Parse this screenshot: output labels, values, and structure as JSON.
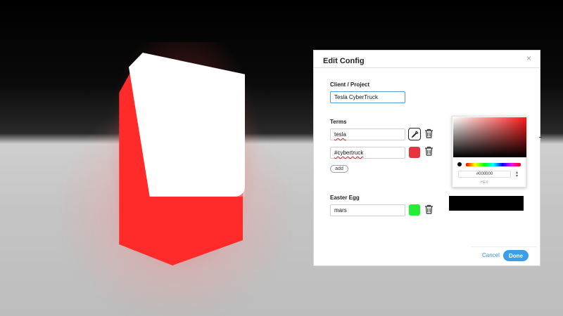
{
  "dialog": {
    "title": "Edit Config",
    "close_label": "×"
  },
  "client": {
    "label": "Client / Project",
    "value": "Tesla CyberTruck"
  },
  "terms": {
    "label": "Terms",
    "items": [
      {
        "value": "tesla",
        "color": "#ffffff"
      },
      {
        "value": "#cybertruck",
        "color": "#e8343e"
      }
    ],
    "add_label": "add"
  },
  "easter_egg": {
    "label": "Easter Egg",
    "value": "mars",
    "color": "#22ee33"
  },
  "picker": {
    "hex_value": "#000000",
    "mode_label": "HEX",
    "preview_color": "#000000"
  },
  "footer": {
    "cancel_label": "Cancel",
    "done_label": "Done"
  },
  "icons": {
    "eyedropper": "eyedropper-icon",
    "trash": "trash-icon",
    "close": "close-icon",
    "updown": "chevron-updown-icon"
  }
}
